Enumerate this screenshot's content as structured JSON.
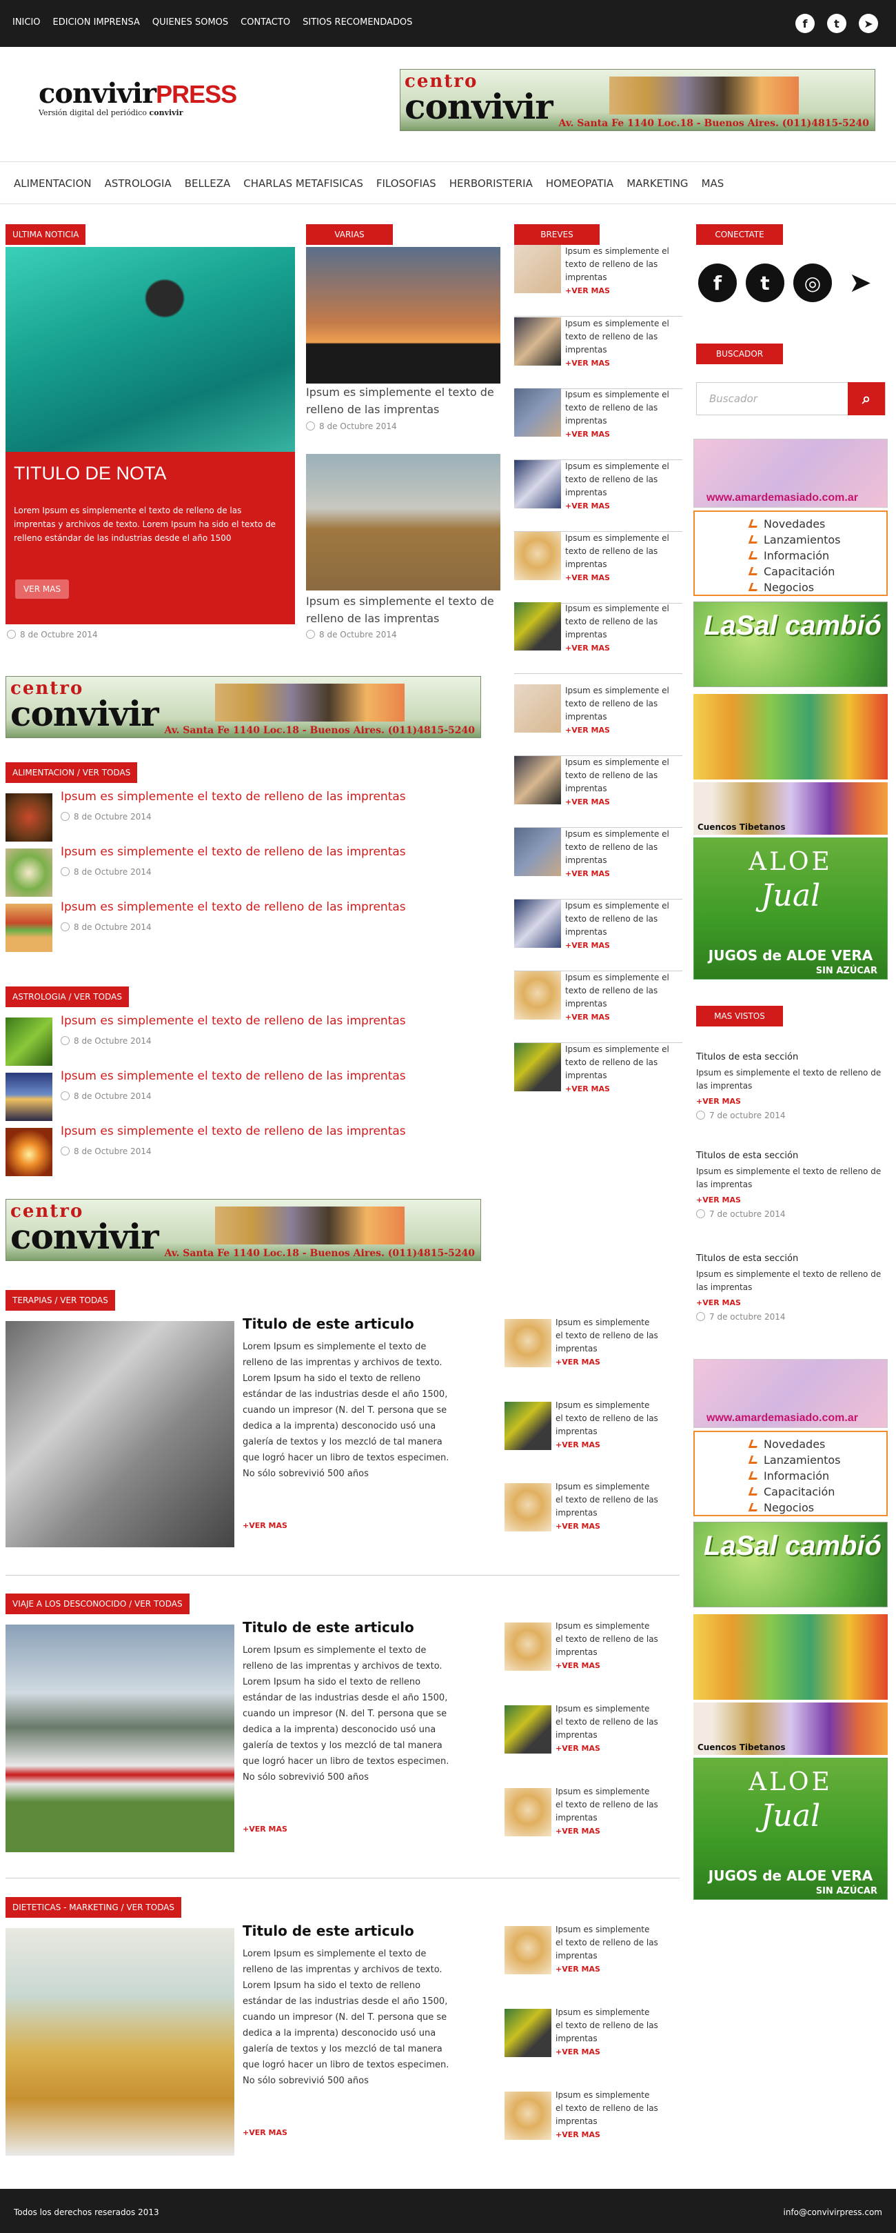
{
  "topnav": [
    "INICIO",
    "EDICION IMPRENSA",
    "QUIENES SOMOS",
    "CONTACTO",
    "SITIOS RECOMENDADOS"
  ],
  "social": [
    "facebook-icon",
    "twitter-icon",
    "telegram-icon"
  ],
  "logo": {
    "main": "convivir",
    "press": "PRESS",
    "sub_a": "Versión digital del periódico ",
    "sub_b": "convivir"
  },
  "banner": {
    "top": "centro",
    "big": "convivir",
    "addr": "Av. Santa Fe 1140 Loc.18 - Buenos Aires. (011)4815-5240"
  },
  "mainnav": [
    "ALIMENTACION",
    "ASTROLOGIA",
    "BELLEZA",
    "CHARLAS METAFISICAS",
    "FILOSOFIAS",
    "HERBORISTERIA",
    "HOMEOPATIA",
    "MARKETING",
    "MAS"
  ],
  "labels": {
    "ultima": "ULTIMA NOTICIA",
    "varias": "VARIAS",
    "breves": "BREVES",
    "conectate": "CONECTATE",
    "buscador": "BUSCADOR",
    "mas_vistos": "MAS VISTOS",
    "alimentacion": "ALIMENTACION / VER TODAS",
    "astrologia": "ASTROLOGIA / VER TODAS",
    "terapias": "TERAPIAS / VER TODAS",
    "viaje": "VIAJE A LOS DESCONOCIDO / VER TODAS",
    "dieteticas": "DIETETICAS - MARKETING / VER TODAS"
  },
  "ultima": {
    "title": "TITULO DE NOTA",
    "text": "Lorem Ipsum es simplemente el texto de relleno de las imprentas y archivos de texto. Lorem Ipsum ha sido el texto de relleno estándar de las industrias desde el año 1500",
    "button": "VER MAS",
    "date": "8 de Octubre 2014"
  },
  "varias": [
    {
      "text": "Ipsum es simplemente el texto de relleno de las imprentas",
      "date": "8 de Octubre 2014"
    },
    {
      "text": "Ipsum es simplemente el texto de relleno de las imprentas",
      "date": "8 de Octubre 2014"
    }
  ],
  "breve_text": "Ipsum es simplemente el texto de relleno de las imprentas",
  "ver_mas": "+VER MAS",
  "cat_item": {
    "title": "Ipsum es simplemente el texto de relleno de las imprentas",
    "date": "8 de Octubre 2014"
  },
  "article": {
    "title": "Titulo de este articulo",
    "text": "Lorem Ipsum es simplemente el texto de relleno de las imprentas y archivos de texto. Lorem Ipsum ha sido el texto de relleno estándar de las industrias desde el año 1500, cuando un impresor (N. del T. persona que se dedica a la imprenta) desconocido usó una galería de textos y los mezcló de tal manera que logró hacer un libro de textos especimen. No sólo sobrevivió 500 años"
  },
  "search_placeholder": "Buscador",
  "ad_menu": [
    "Novedades",
    "Lanzamientos",
    "Información",
    "Capacitación",
    "Negocios"
  ],
  "ads": {
    "hearts": "www.amardemasiado.com.ar",
    "lasal": "LaSal cambió",
    "tibet": "Cuencos Tibetanos",
    "aloe1": "ALOE",
    "aloe2": "Jual",
    "aloe3": "JUGOS de ALOE VERA",
    "aloe4": "SIN AZÚCAR"
  },
  "mas_vistos": {
    "heading": "Titulos de esta sección",
    "text": "Ipsum es simplemente el texto de relleno de las imprentas",
    "date": "7 de octubre 2014"
  },
  "footer": {
    "left": "Todos los derechos reserados 2013",
    "right": "info@convivirpress.com"
  },
  "colors": {
    "accent": "#d11b1b",
    "dark": "#1c1c1c"
  }
}
